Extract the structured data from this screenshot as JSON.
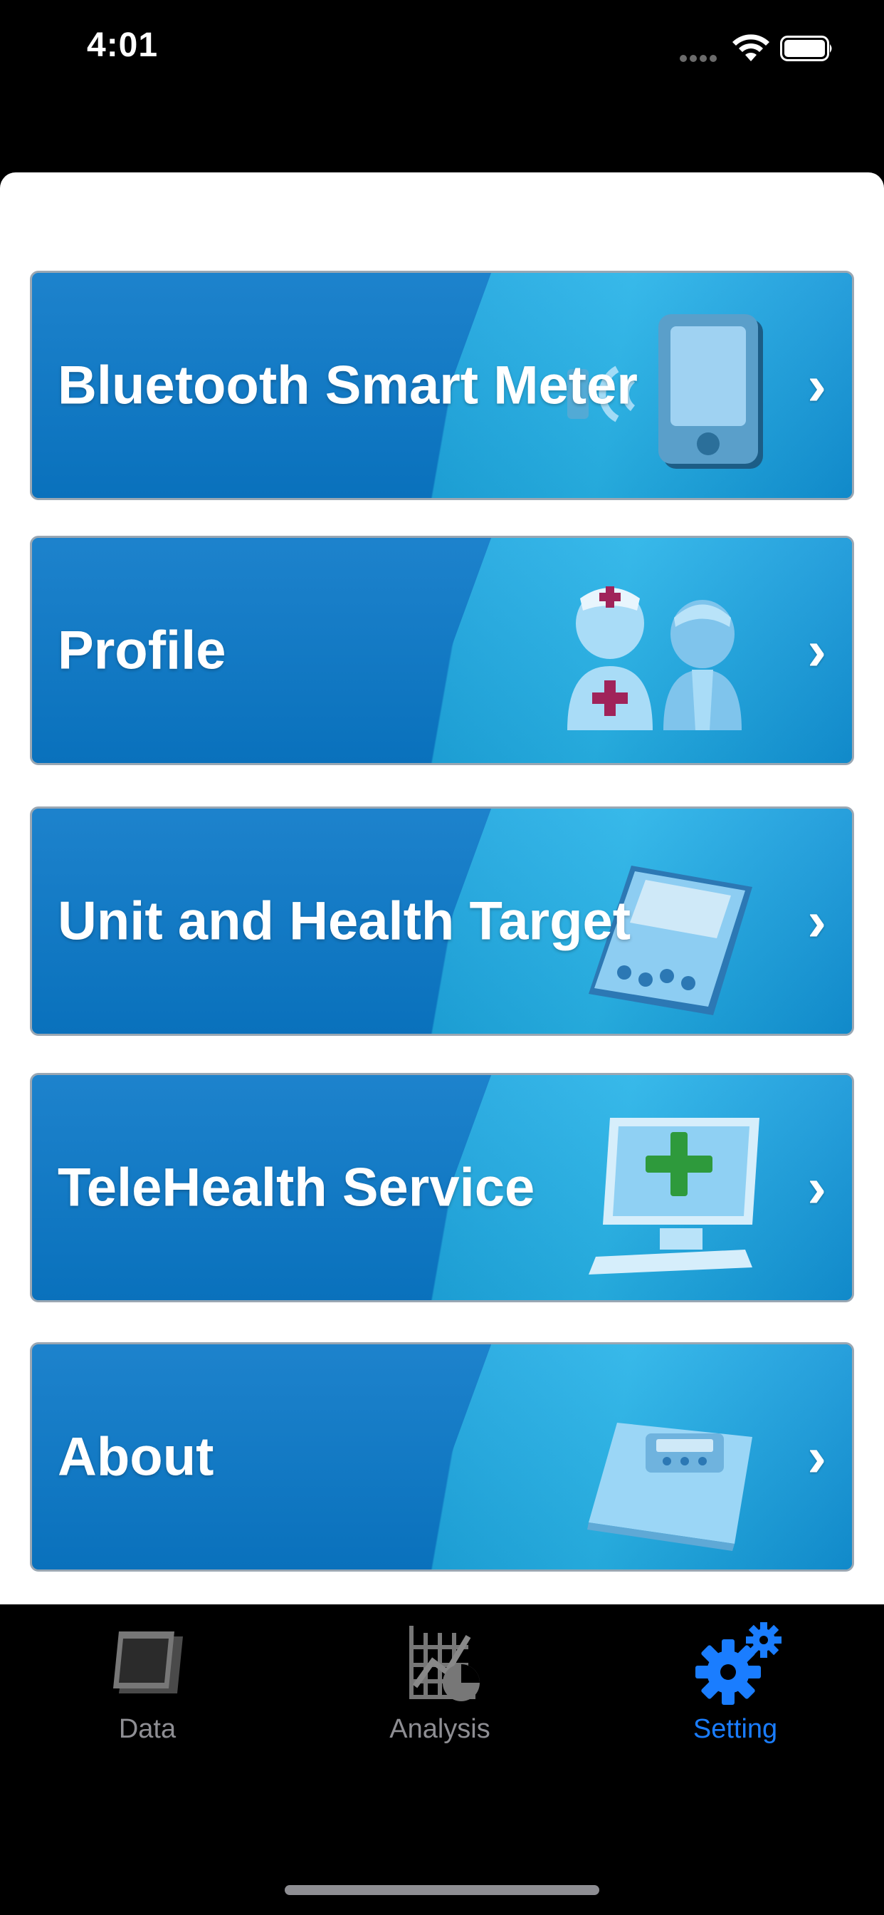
{
  "status_bar": {
    "time": "4:01"
  },
  "menu": {
    "items": [
      {
        "label": "Bluetooth Smart Meter",
        "icon": "phone-bluetooth-icon"
      },
      {
        "label": "Profile",
        "icon": "nurse-patient-icon"
      },
      {
        "label": "Unit and Health Target",
        "icon": "meter-device-icon"
      },
      {
        "label": "TeleHealth Service",
        "icon": "monitor-plus-icon"
      },
      {
        "label": "About",
        "icon": "scale-device-icon"
      }
    ],
    "chevron": "›"
  },
  "tab_bar": {
    "tabs": [
      {
        "label": "Data",
        "icon": "document-icon"
      },
      {
        "label": "Analysis",
        "icon": "chart-icon"
      },
      {
        "label": "Setting",
        "icon": "gear-icon"
      }
    ],
    "active_index": 2
  },
  "colors": {
    "card_blue": "#0a78c8",
    "card_light": "#27b3e8",
    "active_tab": "#1a7dff",
    "inactive_tab": "#8e8e93"
  }
}
